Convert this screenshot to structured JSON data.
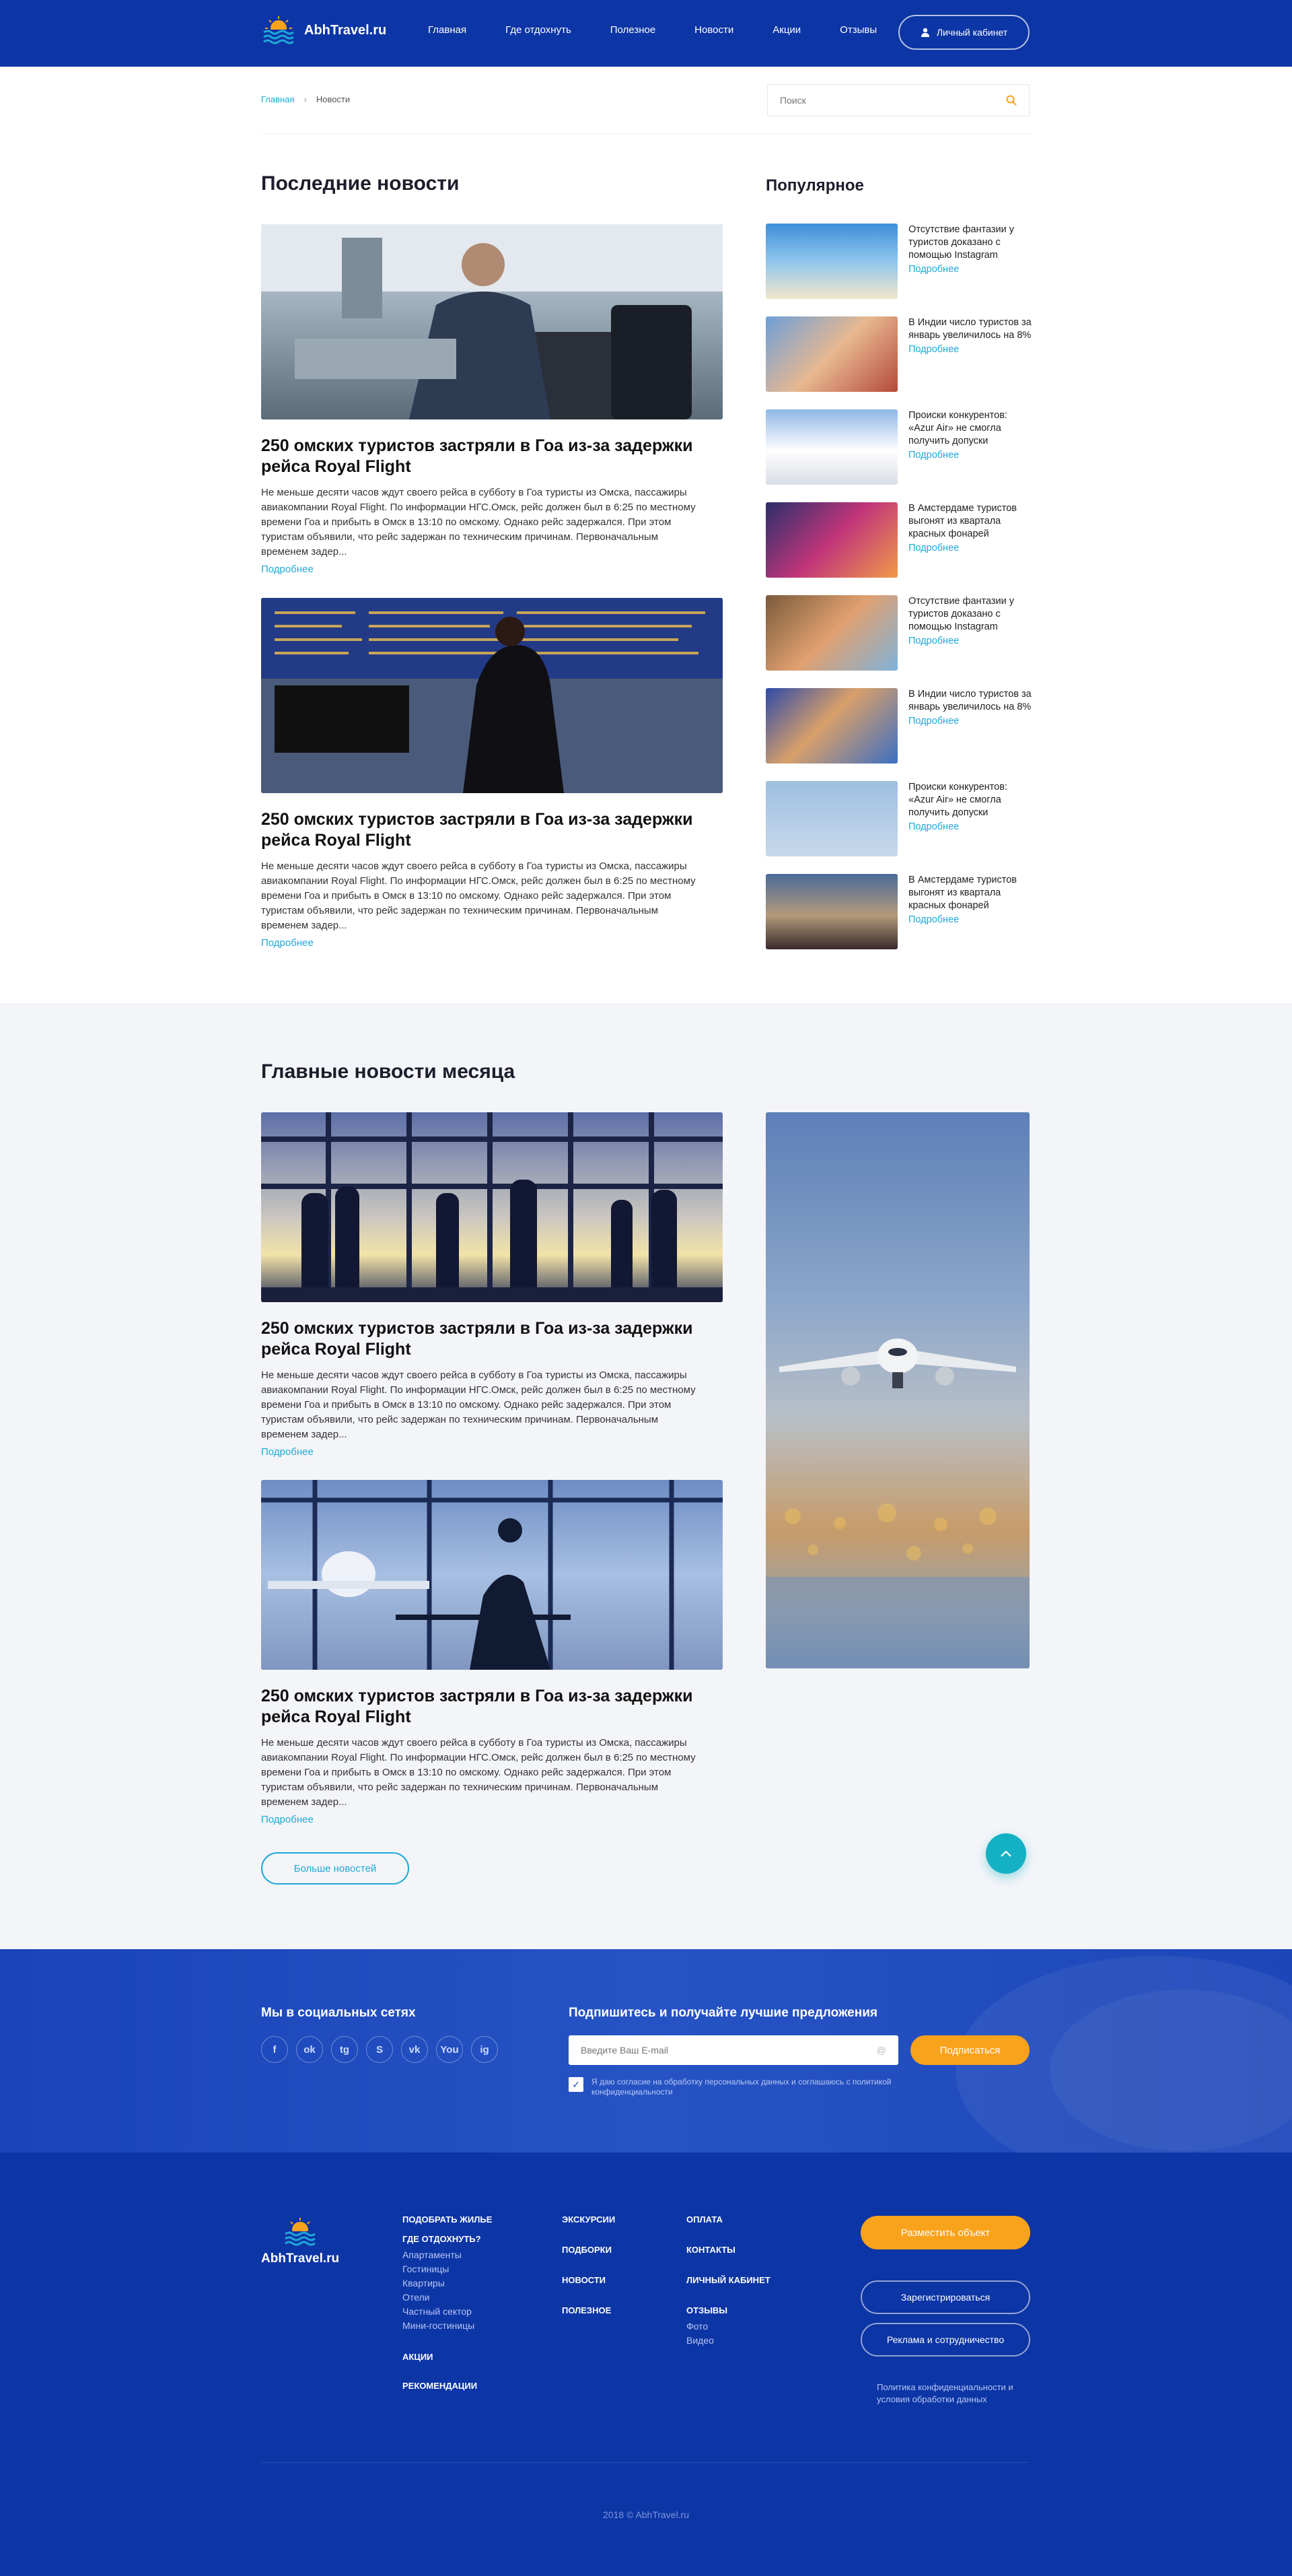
{
  "header": {
    "logo_text": "AbhTravel.ru",
    "nav": [
      "Главная",
      "Где отдохнуть",
      "Полезное",
      "Новости",
      "Акции",
      "Отзывы"
    ],
    "account_label": "Личный кабинет"
  },
  "breadcrumb": {
    "home": "Главная",
    "current": "Новости"
  },
  "search": {
    "placeholder": "Поиск"
  },
  "latest": {
    "title": "Последние новости",
    "items": [
      {
        "title": "250 омских туристов застряли в Гоа из-за задержки рейса Royal Flight",
        "text": "Не меньше десяти часов ждут своего рейса в субботу в Гоа туристы из Омска, пассажиры авиакомпании Royal Flight. По информации НГС.Омск, рейс должен был в 6:25 по местному времени Гоа и прибыть в Омск в 13:10 по омскому. Однако рейс задержался. При этом туристам объявили, что рейс задержан по техническим причинам. Первоначальным временем задер...",
        "more": "Подробнее"
      },
      {
        "title": "250 омских туристов застряли в Гоа из-за задержки рейса Royal Flight",
        "text": "Не меньше десяти часов ждут своего рейса в субботу в Гоа туристы из Омска, пассажиры авиакомпании Royal Flight. По информации НГС.Омск, рейс должен был в 6:25 по местному времени Гоа и прибыть в Омск в 13:10 по омскому. Однако рейс задержался. При этом туристам объявили, что рейс задержан по техническим причинам. Первоначальным временем задер...",
        "more": "Подробнее"
      }
    ]
  },
  "popular": {
    "title": "Популярное",
    "items": [
      {
        "title": "Отсутствие фантазии у туристов доказано с помощью Instagram",
        "more": "Подробнее"
      },
      {
        "title": "В Индии число туристов за январь увеличилось на 8%",
        "more": "Подробнее"
      },
      {
        "title": "Происки конкурентов: «Azur Air» не смогла получить допуски",
        "more": "Подробнее"
      },
      {
        "title": "В Амстердаме туристов выгонят из квартала красных фонарей",
        "more": "Подробнее"
      },
      {
        "title": "Отсутствие фантазии у туристов доказано с помощью Instagram",
        "more": "Подробнее"
      },
      {
        "title": "В Индии число туристов за январь увеличилось на 8%",
        "more": "Подробнее"
      },
      {
        "title": "Происки конкурентов: «Azur Air» не смогла получить допуски",
        "more": "Подробнее"
      },
      {
        "title": "В Амстердаме туристов выгонят из квартала красных фонарей",
        "more": "Подробнее"
      }
    ]
  },
  "month": {
    "title": "Главные новости месяца",
    "items": [
      {
        "title": "250 омских туристов застряли в Гоа из-за задержки рейса Royal Flight",
        "text": "Не меньше десяти часов ждут своего рейса в субботу в Гоа туристы из Омска, пассажиры авиакомпании Royal Flight. По информации НГС.Омск, рейс должен был в 6:25 по местному времени Гоа и прибыть в Омск в 13:10 по омскому. Однако рейс задержался. При этом туристам объявили, что рейс задержан по техническим причинам. Первоначальным временем задер...",
        "more": "Подробнее"
      },
      {
        "title": "250 омских туристов застряли в Гоа из-за задержки рейса Royal Flight",
        "text": "Не меньше десяти часов ждут своего рейса в субботу в Гоа туристы из Омска, пассажиры авиакомпании Royal Flight. По информации НГС.Омск, рейс должен был в 6:25 по местному времени Гоа и прибыть в Омск в 13:10 по омскому. Однако рейс задержался. При этом туристам объявили, что рейс задержан по техническим причинам. Первоначальным временем задер...",
        "more": "Подробнее"
      }
    ],
    "more_button": "Больше новостей"
  },
  "subscribe": {
    "social_title": "Мы в социальных сетях",
    "socials": [
      "f",
      "ok",
      "tg",
      "S",
      "vk",
      "You",
      "ig"
    ],
    "title": "Подпишитесь и получайте лучшие предложения",
    "email_placeholder": "Введите Ваш E-mail",
    "button": "Подписаться",
    "agree": "Я даю согласие на обработку персональных данных и соглашаюсь с политикой конфиденциальности"
  },
  "footer": {
    "logo_text": "AbhTravel.ru",
    "col1": {
      "h1": "Подобрать жилье",
      "h2": "Где отдохнуть?",
      "links": [
        "Апартаменты",
        "Гостиницы",
        "Квартиры",
        "Отели",
        "Частный сектор",
        "Мини-гостиницы"
      ],
      "h3": "Акции",
      "h4": "Рекомендации"
    },
    "col2": [
      "Экскурсии",
      "Подборки",
      "Новости",
      "Полезное"
    ],
    "col3": {
      "items": [
        "Оплата",
        "Контакты",
        "Личный кабинет",
        "Отзывы"
      ],
      "links": [
        "Фото",
        "Видео"
      ]
    },
    "place_button": "Разместить объект",
    "register_button": "Зарегистрироваться",
    "ads_button": "Реклама и сотрудничество",
    "policy": "Политика конфиденциальности и условия обработки данных",
    "copyright": "2018 © AbhTravel.ru"
  },
  "colors": {
    "brand": "#0c35a5",
    "accent": "#f9a21b",
    "link": "#1fa8d9"
  }
}
